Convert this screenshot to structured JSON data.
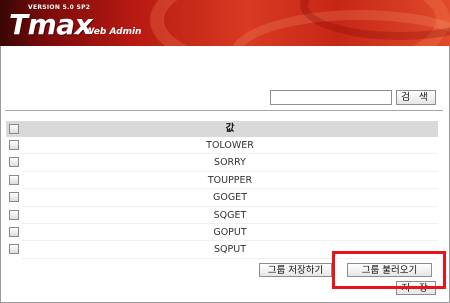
{
  "app": {
    "logo_version": "VERSION 5.0 SP2",
    "logo_title": "Tmax",
    "logo_subtitle": "/ Web Admin"
  },
  "search": {
    "input_value": "",
    "button_label": "검 색"
  },
  "table": {
    "column_header": "값",
    "rows": [
      "TOLOWER",
      "SORRY",
      "TOUPPER",
      "GOGET",
      "SQGET",
      "GOPUT",
      "SQPUT"
    ]
  },
  "actions": {
    "save_group_label": "그룹 저장하기",
    "load_group_label": "그룹 불러오기",
    "save_label": "저 장"
  },
  "colors": {
    "highlight": "#e8141b",
    "header_gradient_main": "#b81a12"
  }
}
